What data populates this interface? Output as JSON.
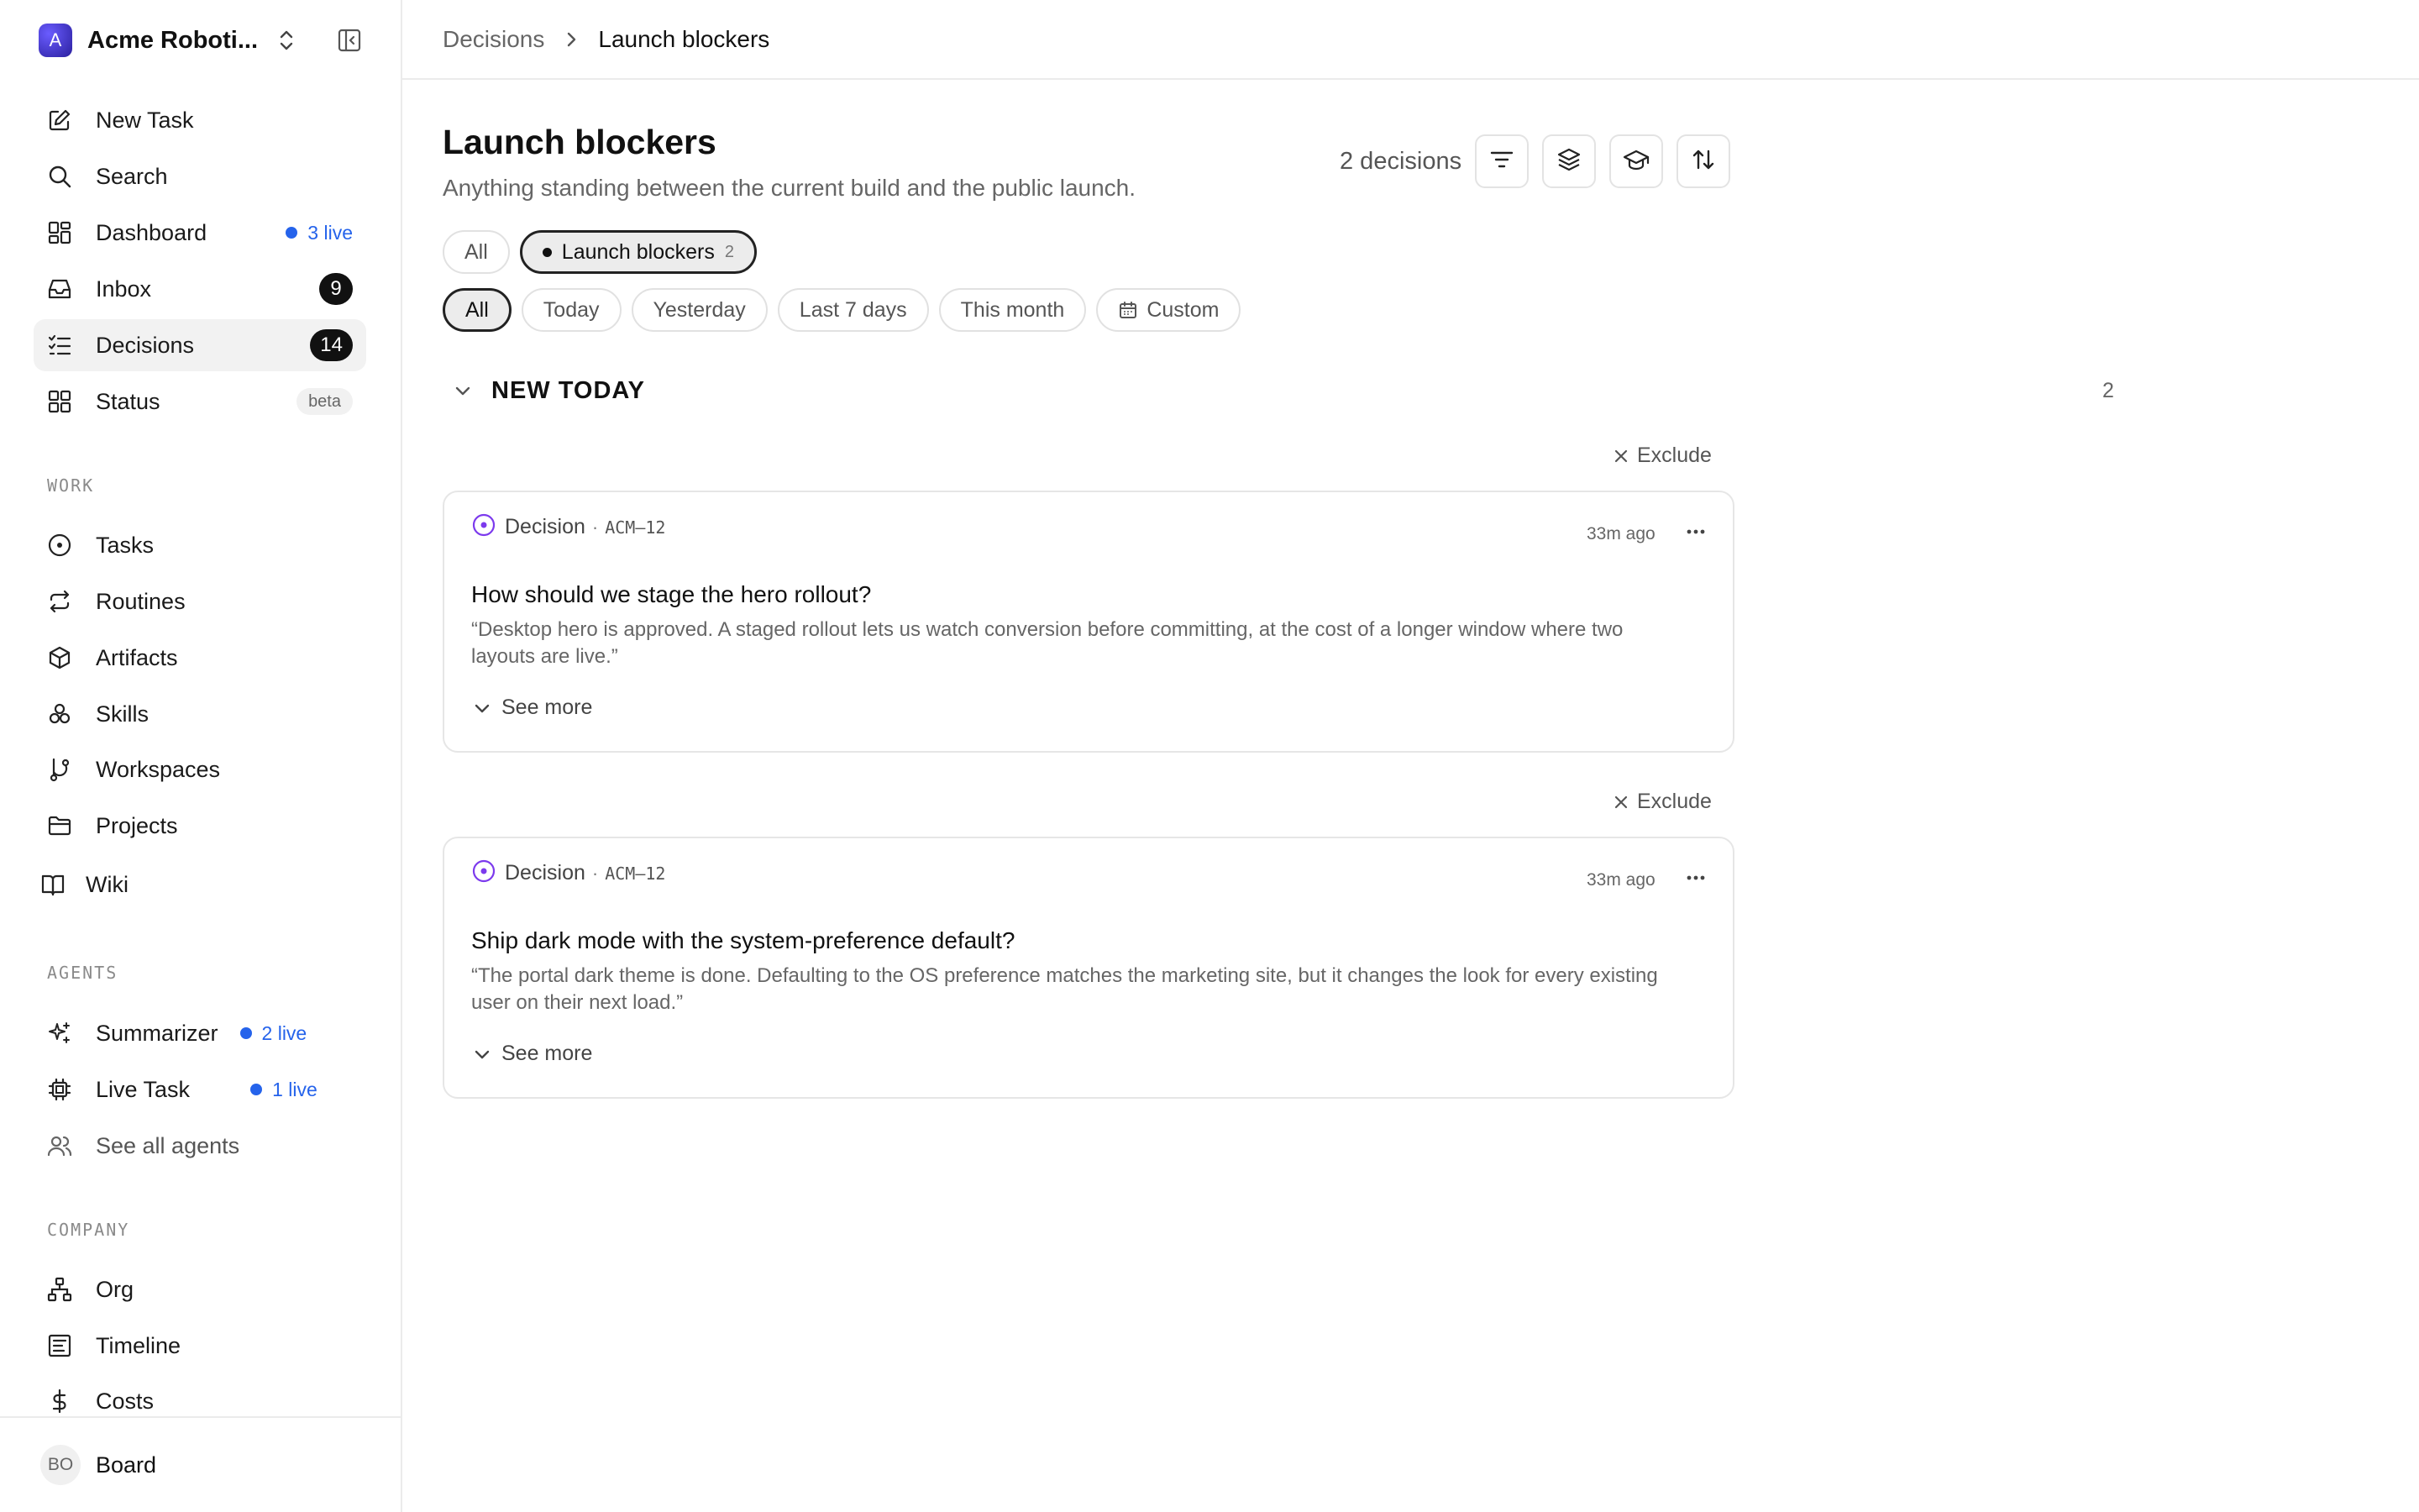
{
  "workspace": {
    "name": "Acme Roboti...",
    "logo_letter": "A"
  },
  "nav_primary": [
    {
      "label": "New Task",
      "icon": "edit-icon"
    },
    {
      "label": "Search",
      "icon": "search-icon"
    },
    {
      "label": "Dashboard",
      "icon": "dashboard-icon",
      "live": "3 live"
    },
    {
      "label": "Inbox",
      "icon": "inbox-icon",
      "count": "9"
    },
    {
      "label": "Decisions",
      "icon": "list-check-icon",
      "count": "14",
      "active": true
    },
    {
      "label": "Status",
      "icon": "grid-icon",
      "badge": "beta"
    }
  ],
  "sections": {
    "work": "WORK",
    "agents": "AGENTS",
    "company": "COMPANY"
  },
  "nav_work": [
    {
      "label": "Tasks",
      "icon": "circle-dot-icon"
    },
    {
      "label": "Routines",
      "icon": "repeat-icon"
    },
    {
      "label": "Artifacts",
      "icon": "box-icon"
    },
    {
      "label": "Skills",
      "icon": "skills-icon"
    },
    {
      "label": "Workspaces",
      "icon": "git-branch-icon"
    },
    {
      "label": "Projects",
      "icon": "folder-icon"
    },
    {
      "label": "Wiki",
      "icon": "book-icon"
    }
  ],
  "nav_agents": [
    {
      "label": "Summarizer",
      "icon": "sparkles-icon",
      "live": "2 live"
    },
    {
      "label": "Live Task",
      "icon": "cpu-icon",
      "live": "1 live"
    },
    {
      "label": "See all agents",
      "icon": "users-icon"
    }
  ],
  "nav_company": [
    {
      "label": "Org",
      "icon": "org-chart-icon"
    },
    {
      "label": "Timeline",
      "icon": "timeline-icon"
    },
    {
      "label": "Costs",
      "icon": "dollar-icon"
    }
  ],
  "footer": {
    "avatar": "BO",
    "label": "Board"
  },
  "breadcrumb": {
    "parent": "Decisions",
    "current": "Launch blockers"
  },
  "page": {
    "title": "Launch blockers",
    "subtitle": "Anything standing between the current build and the public launch.",
    "count_label": "2 decisions"
  },
  "scope_chips": [
    {
      "label": "All"
    },
    {
      "label": "Launch blockers",
      "count": "2",
      "selected": true
    }
  ],
  "date_chips": [
    {
      "label": "All",
      "selected": true
    },
    {
      "label": "Today"
    },
    {
      "label": "Yesterday"
    },
    {
      "label": "Last 7 days"
    },
    {
      "label": "This month"
    },
    {
      "label": "Custom"
    }
  ],
  "group": {
    "title": "NEW TODAY",
    "count": "2"
  },
  "exclude_label": "Exclude",
  "cards": [
    {
      "type": "Decision",
      "id": "ACM–12",
      "time": "33m ago",
      "title": "How should we stage the hero rollout?",
      "body": "“Desktop hero is approved. A staged rollout lets us watch conversion before committing, at the cost of a longer window where two layouts are live.”",
      "see_more": "See more"
    },
    {
      "type": "Decision",
      "id": "ACM–12",
      "time": "33m ago",
      "title": "Ship dark mode with the system-preference default?",
      "body": "“The portal dark theme is done. Defaulting to the OS preference matches the marketing site, but it changes the look for every existing user on their next load.”",
      "see_more": "See more"
    }
  ],
  "colors": {
    "accent_live": "#2563eb",
    "decision_purple": "#7c3aed",
    "badge_dark": "#111111"
  }
}
